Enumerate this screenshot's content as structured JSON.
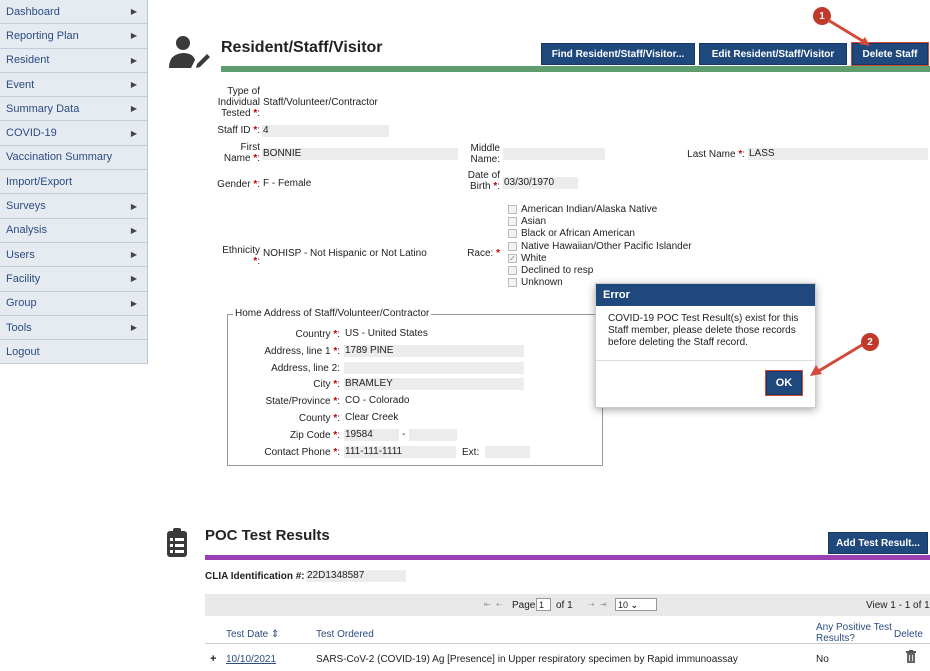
{
  "nav": [
    {
      "label": "Dashboard",
      "arrow": true
    },
    {
      "label": "Reporting Plan",
      "arrow": true
    },
    {
      "label": "Resident",
      "arrow": true
    },
    {
      "label": "Event",
      "arrow": true
    },
    {
      "label": "Summary Data",
      "arrow": true
    },
    {
      "label": "COVID-19",
      "arrow": true
    },
    {
      "label": "Vaccination Summary",
      "arrow": false
    },
    {
      "label": "Import/Export",
      "arrow": false
    },
    {
      "label": "Surveys",
      "arrow": true
    },
    {
      "label": "Analysis",
      "arrow": true
    },
    {
      "label": "Users",
      "arrow": true
    },
    {
      "label": "Facility",
      "arrow": true
    },
    {
      "label": "Group",
      "arrow": true
    },
    {
      "label": "Tools",
      "arrow": true
    },
    {
      "label": "Logout",
      "arrow": false
    }
  ],
  "section_title": "Resident/Staff/Visitor",
  "buttons": {
    "find": "Find Resident/Staff/Visitor...",
    "edit": "Edit Resident/Staff/Visitor",
    "delete": "Delete Staff",
    "add_test": "Add Test Result..."
  },
  "colors": {
    "accent_green": "#5e9e6e",
    "accent_purple": "#9b3fb5",
    "button_blue": "#1f497d",
    "badge_red": "#c0392b"
  },
  "form": {
    "type_label_1": "Type of",
    "type_label_2": "Individual",
    "type_label_3": "Tested",
    "type_value": "Staff/Volunteer/Contractor",
    "staff_id_label": "Staff ID",
    "staff_id": "4",
    "first_name_label_1": "First",
    "first_name_label_2": "Name",
    "first_name": "BONNIE",
    "middle_label_1": "Middle",
    "middle_label_2": "Name:",
    "middle_name": "",
    "last_name_label": "Last Name",
    "last_name": "LASS",
    "gender_label": "Gender",
    "gender": "F - Female",
    "dob_label_1": "Date of",
    "dob_label_2": "Birth",
    "dob": "03/30/1970",
    "ethnicity_label": "Ethnicity",
    "ethnicity": "NOHISP - Not Hispanic or Not Latino",
    "race_label": "Race:",
    "race_options": [
      {
        "label": "American Indian/Alaska Native",
        "checked": false
      },
      {
        "label": "Asian",
        "checked": false
      },
      {
        "label": "Black or African American",
        "checked": false
      },
      {
        "label": "Native Hawaiian/Other Pacific Islander",
        "checked": false
      },
      {
        "label": "White",
        "checked": true
      },
      {
        "label": "Declined to resp",
        "checked": false
      },
      {
        "label": "Unknown",
        "checked": false
      }
    ]
  },
  "address": {
    "legend": "Home Address of Staff/Volunteer/Contractor",
    "country_label": "Country",
    "country": "US - United States",
    "line1_label": "Address, line 1",
    "line1": "1789 PINE",
    "line2_label": "Address, line 2:",
    "line2": "",
    "city_label": "City",
    "city": "BRAMLEY",
    "state_label": "State/Province",
    "state": "CO - Colorado",
    "county_label": "County",
    "county": "Clear Creek",
    "zip_label": "Zip Code",
    "zip": "19584",
    "zip_ext": "",
    "phone_label": "Contact Phone",
    "phone": "111-111-1111",
    "ext_label": "Ext:",
    "ext": ""
  },
  "dialog": {
    "title": "Error",
    "message": "COVID-19 POC Test Result(s) exist for this Staff member, please delete those records before deleting the Staff record.",
    "ok": "OK"
  },
  "annotations": {
    "badge1": "1",
    "badge2": "2"
  },
  "poc": {
    "title": "POC Test Results",
    "clia_label": "CLIA Identification #:",
    "clia": "22D1348587",
    "pager": {
      "page_label": "Page",
      "page": "1",
      "of_label": "of 1",
      "per_page": "10",
      "view": "View 1 - 1 of 1"
    },
    "columns": {
      "date": "Test Date",
      "ordered": "Test Ordered",
      "positive_1": "Any Positive Test",
      "positive_2": "Results?",
      "delete": "Delete"
    },
    "rows": [
      {
        "expand": "+",
        "date": "10/10/2021",
        "ordered": "SARS-CoV-2 (COVID-19) Ag [Presence] in Upper respiratory specimen by Rapid immunoassay",
        "positive": "No"
      }
    ]
  }
}
